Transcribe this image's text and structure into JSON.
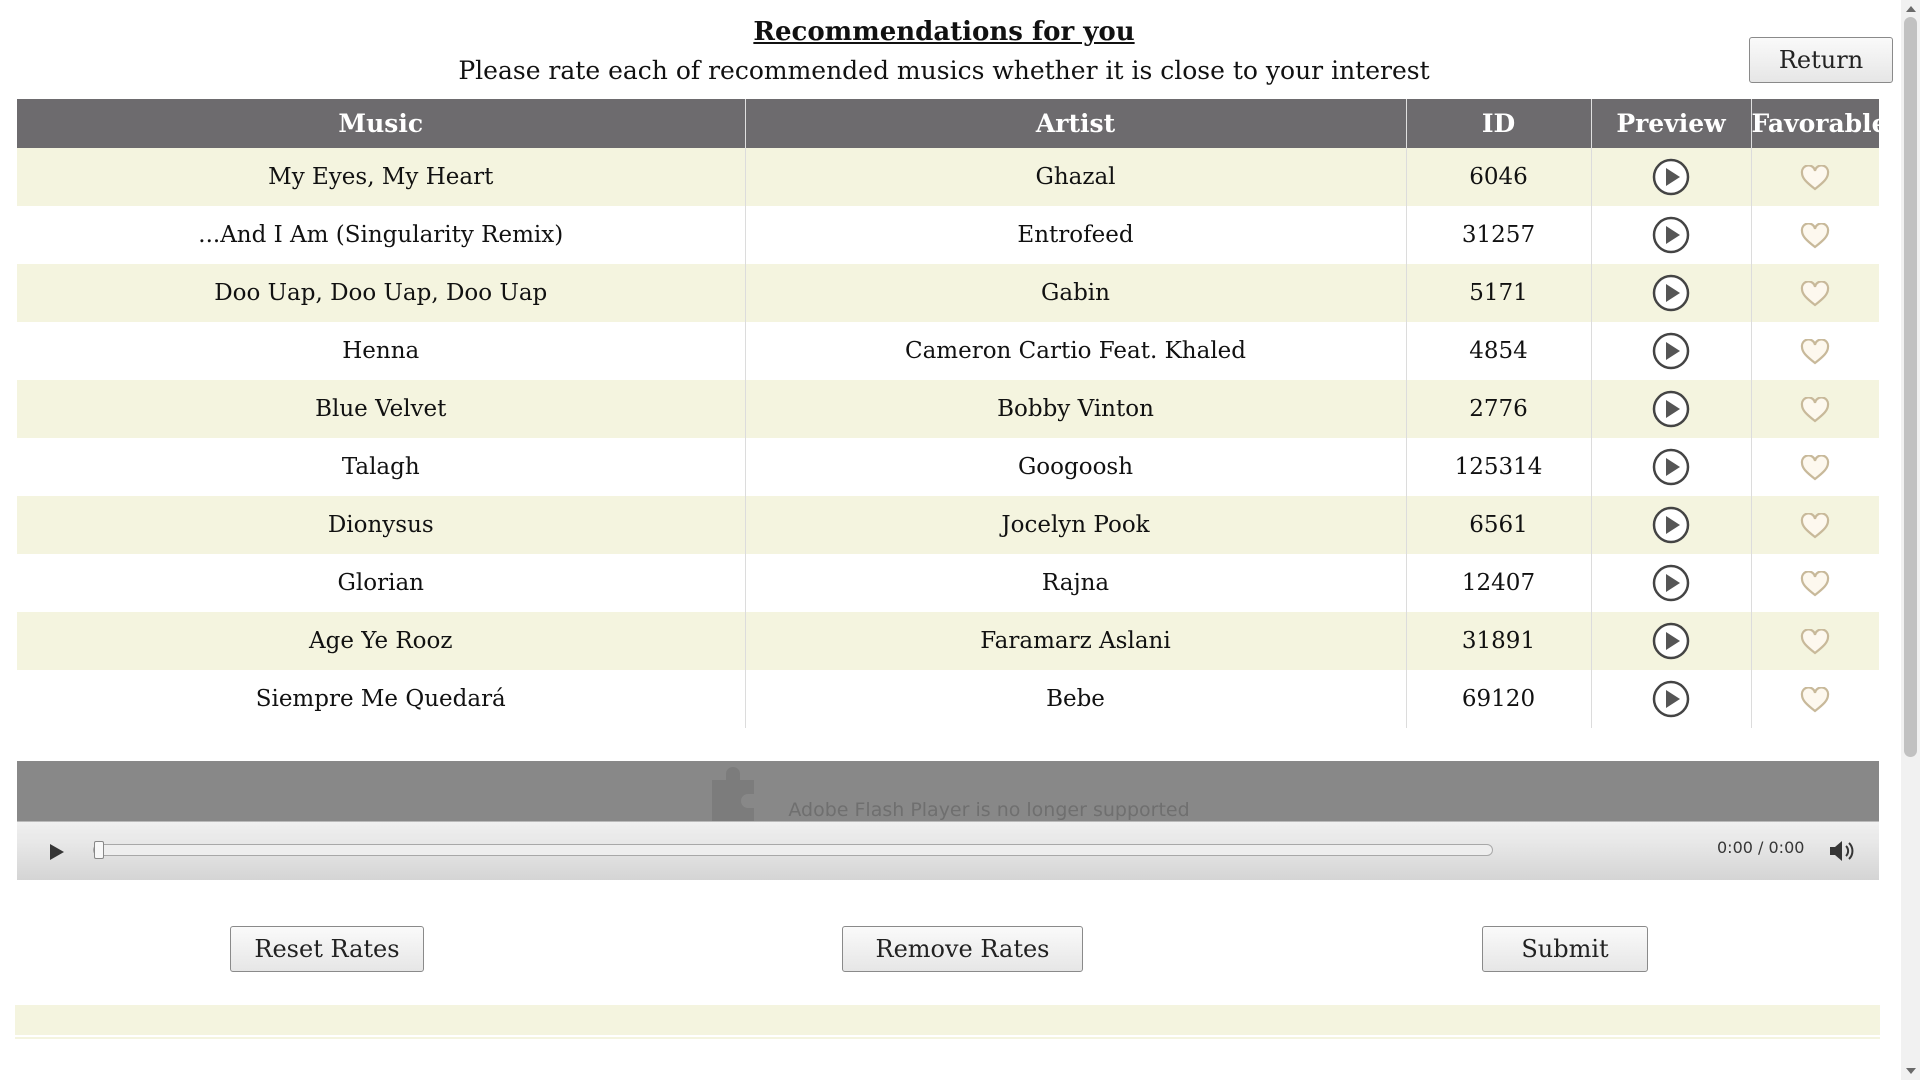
{
  "header": {
    "title": "Recommendations for you",
    "subtitle": "Please rate each of recommended musics whether it is close to your interest",
    "return_label": "Return"
  },
  "table": {
    "columns": [
      "Music",
      "Artist",
      "ID",
      "Preview",
      "Favorable"
    ],
    "rows": [
      {
        "music": "My Eyes, My Heart",
        "artist": "Ghazal",
        "id": "6046"
      },
      {
        "music": "...And I Am (Singularity Remix)",
        "artist": "Entrofeed",
        "id": "31257"
      },
      {
        "music": "Doo Uap, Doo Uap, Doo Uap",
        "artist": "Gabin",
        "id": "5171"
      },
      {
        "music": "Henna",
        "artist": "Cameron Cartio Feat. Khaled",
        "id": "4854"
      },
      {
        "music": "Blue Velvet",
        "artist": "Bobby Vinton",
        "id": "2776"
      },
      {
        "music": "Talagh",
        "artist": "Googoosh",
        "id": "125314"
      },
      {
        "music": "Dionysus",
        "artist": "Jocelyn Pook",
        "id": "6561"
      },
      {
        "music": "Glorian",
        "artist": "Rajna",
        "id": "12407"
      },
      {
        "music": "Age Ye Rooz",
        "artist": "Faramarz Aslani",
        "id": "31891"
      },
      {
        "music": "Siempre Me Quedará",
        "artist": "Bebe",
        "id": "69120"
      }
    ],
    "preview_icon": "play-circle-icon",
    "favorable_icon": "heart-outline-icon"
  },
  "player": {
    "flash_message": "Adobe Flash Player is no longer supported",
    "time": "0:00 / 0:00",
    "progress": 0
  },
  "actions": {
    "reset_label": "Reset Rates",
    "remove_label": "Remove Rates",
    "submit_label": "Submit"
  },
  "colors": {
    "header_bg": "#6d6b6e",
    "odd_row_bg": "#f4f4df",
    "heart": "#c8b99a"
  }
}
